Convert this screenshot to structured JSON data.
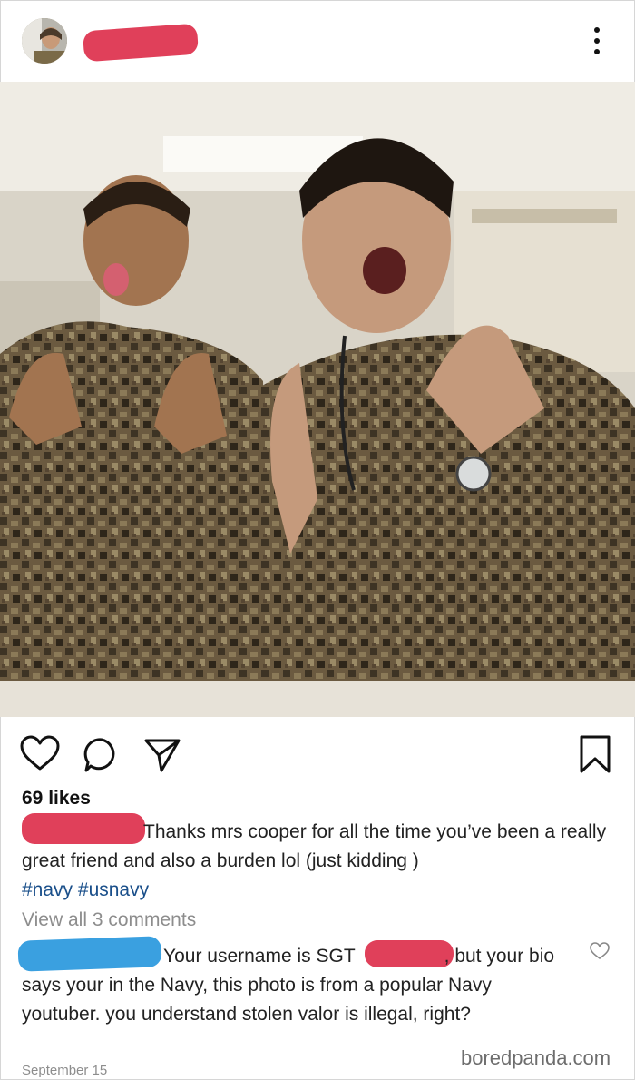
{
  "post": {
    "likes": "69 likes",
    "caption_text": "Thanks mrs cooper for all the time you’ve been a really great friend and also a burden lol (just kidding )",
    "hashtags": [
      "#navy",
      "#usnavy"
    ],
    "view_comments": "View all 3 comments",
    "comment_text_1": "Your username is SGT",
    "comment_text_2": ", but your bio says your in the Navy, this photo is from a popular Navy youtuber. you understand stolen valor is illegal, right?",
    "date": "September 15"
  },
  "icons": {
    "more": "more-vertical-icon",
    "like": "heart-icon",
    "comment": "comment-bubble-icon",
    "share": "paper-plane-icon",
    "save": "bookmark-icon",
    "comment_like": "heart-outline-icon"
  },
  "colors": {
    "redaction_red": "#e0405a",
    "redaction_blue": "#3aa0e0",
    "hashtag": "#1a4f8a",
    "muted": "#8d8d8d"
  },
  "watermark": "boredpanda.com"
}
